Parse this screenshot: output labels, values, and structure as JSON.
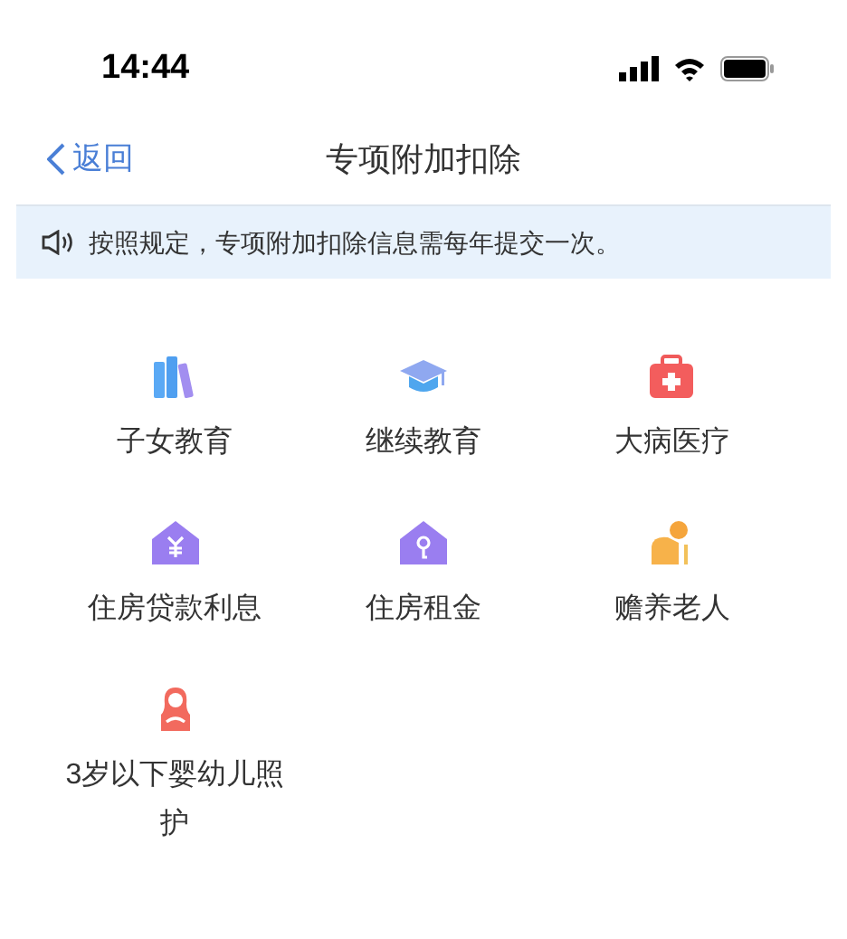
{
  "status_bar": {
    "time": "14:44"
  },
  "nav": {
    "back": "返回",
    "title": "专项附加扣除"
  },
  "notice": {
    "text": "按照规定，专项附加扣除信息需每年提交一次。"
  },
  "items": [
    {
      "label": "子女教育",
      "kind": "books"
    },
    {
      "label": "继续教育",
      "kind": "cap"
    },
    {
      "label": "大病医疗",
      "kind": "medkit"
    },
    {
      "label": "住房贷款利息",
      "kind": "house-yuan"
    },
    {
      "label": "住房租金",
      "kind": "house-key"
    },
    {
      "label": "赡养老人",
      "kind": "elder"
    },
    {
      "label": "3岁以下婴幼儿照护",
      "kind": "mother"
    }
  ]
}
